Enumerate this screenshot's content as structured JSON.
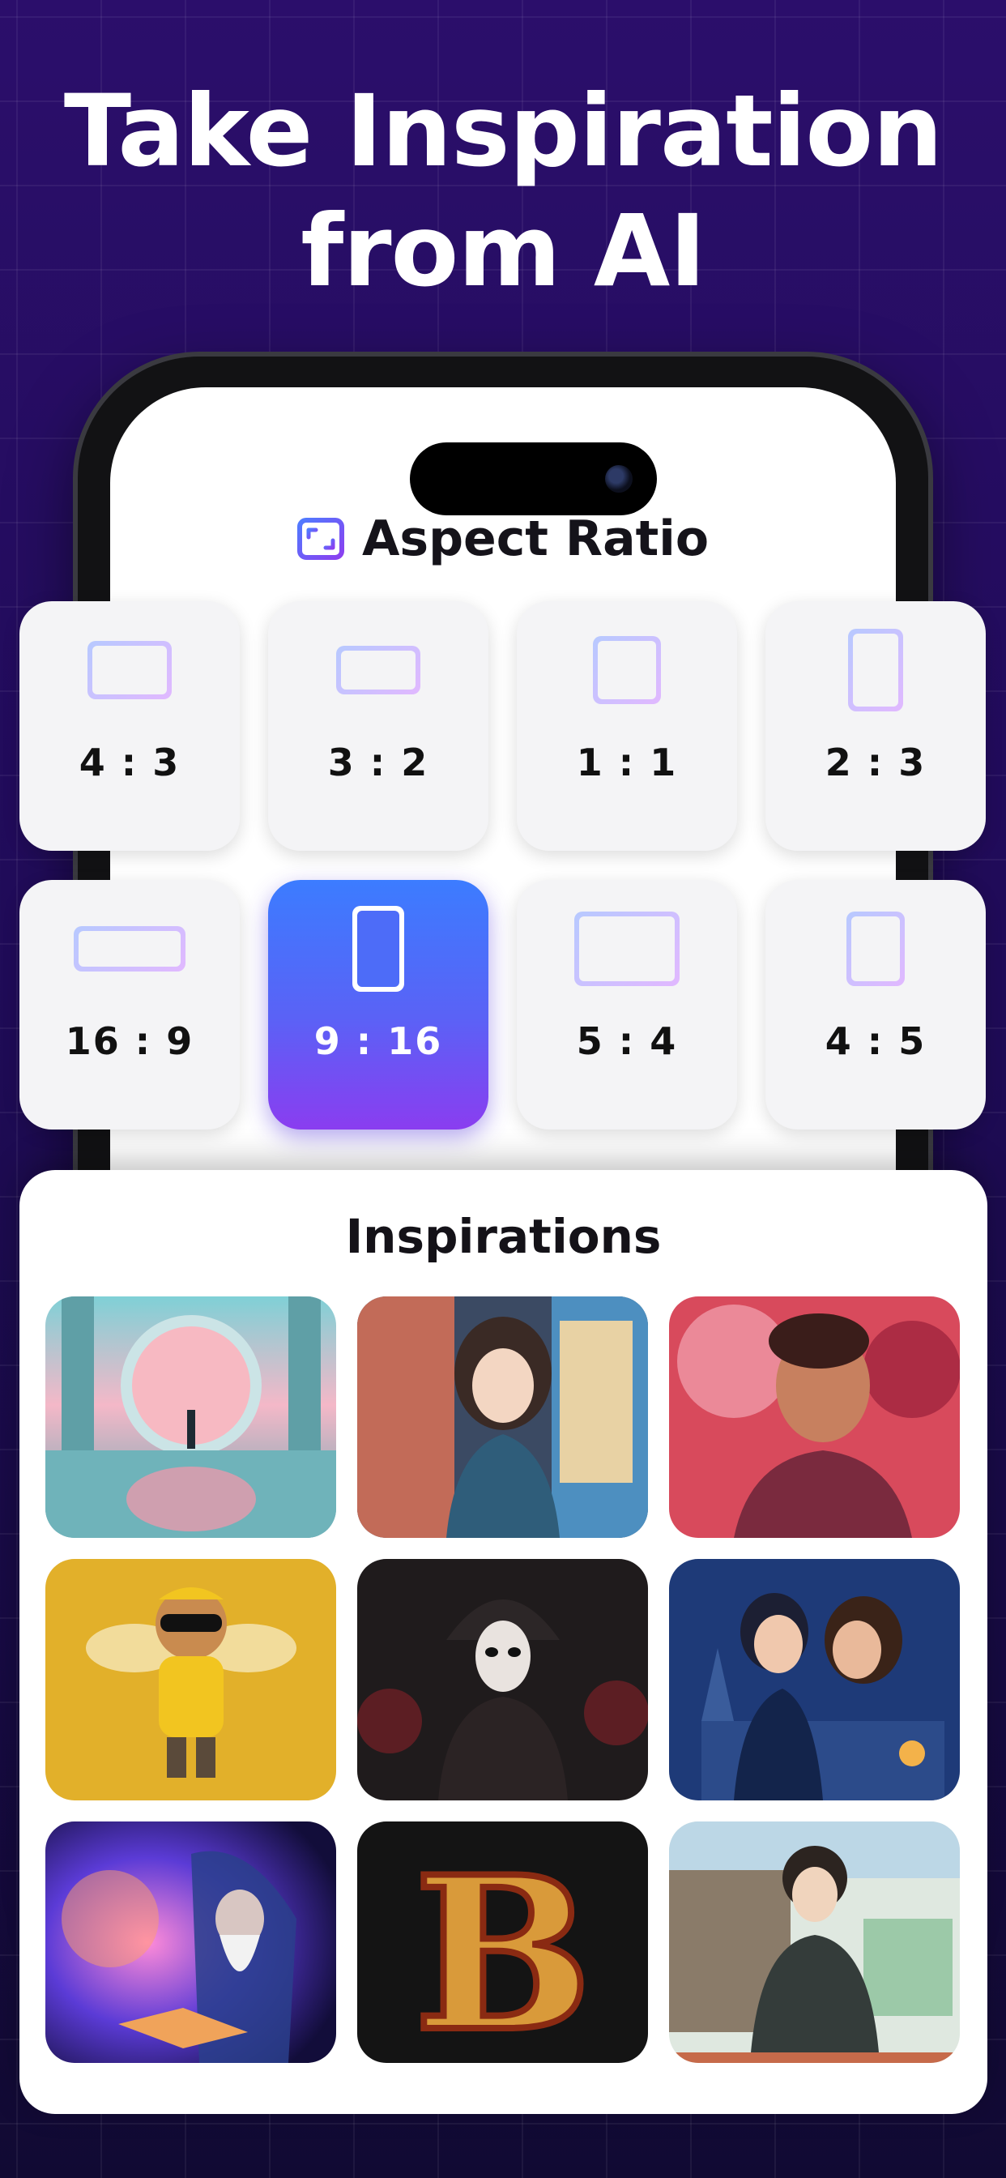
{
  "headline": {
    "line1": "Take Inspiration",
    "line2": "from AI"
  },
  "aspect": {
    "title": "Aspect Ratio",
    "icon": "aspect-ratio-icon",
    "selected": "9 : 16",
    "options": [
      {
        "label": "4 : 3"
      },
      {
        "label": "3 : 2"
      },
      {
        "label": "1 : 1"
      },
      {
        "label": "2 : 3"
      },
      {
        "label": "16 : 9"
      },
      {
        "label": "9 : 16"
      },
      {
        "label": "5 : 4"
      },
      {
        "label": "4 : 5"
      }
    ]
  },
  "inspirations": {
    "title": "Inspirations",
    "images": [
      "portal-reflection-image",
      "anime-girl-vending-image",
      "man-red-splash-image",
      "cartoon-bee-image",
      "masked-woman-image",
      "anime-couple-castle-image",
      "wizard-cosmic-book-image",
      "ornate-letter-b-image",
      "anime-samurai-image"
    ]
  },
  "colors": {
    "background": "#2a0e6b",
    "accent_start": "#3c7cff",
    "accent_end": "#8a3df0",
    "tile": "#f4f4f6"
  }
}
